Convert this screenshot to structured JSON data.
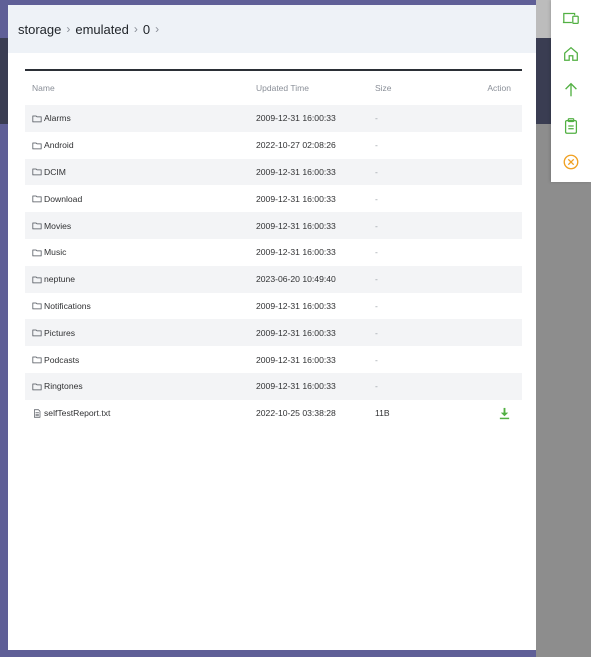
{
  "breadcrumb": [
    {
      "label": "storage"
    },
    {
      "label": "emulated"
    },
    {
      "label": "0"
    }
  ],
  "breadcrumb_separator": "›",
  "table": {
    "columns": {
      "name": "Name",
      "time": "Updated Time",
      "size": "Size",
      "action": "Action"
    },
    "rows": [
      {
        "name": "Alarms",
        "time": "2009-12-31  16:00:33",
        "size": "-",
        "type": "folder"
      },
      {
        "name": "Android",
        "time": "2022-10-27  02:08:26",
        "size": "-",
        "type": "folder"
      },
      {
        "name": "DCIM",
        "time": "2009-12-31  16:00:33",
        "size": "-",
        "type": "folder"
      },
      {
        "name": "Download",
        "time": "2009-12-31  16:00:33",
        "size": "-",
        "type": "folder"
      },
      {
        "name": "Movies",
        "time": "2009-12-31  16:00:33",
        "size": "-",
        "type": "folder"
      },
      {
        "name": "Music",
        "time": "2009-12-31  16:00:33",
        "size": "-",
        "type": "folder"
      },
      {
        "name": "neptune",
        "time": "2023-06-20  10:49:40",
        "size": "-",
        "type": "folder"
      },
      {
        "name": "Notifications",
        "time": "2009-12-31  16:00:33",
        "size": "-",
        "type": "folder"
      },
      {
        "name": "Pictures",
        "time": "2009-12-31  16:00:33",
        "size": "-",
        "type": "folder"
      },
      {
        "name": "Podcasts",
        "time": "2009-12-31  16:00:33",
        "size": "-",
        "type": "folder"
      },
      {
        "name": "Ringtones",
        "time": "2009-12-31  16:00:33",
        "size": "-",
        "type": "folder"
      },
      {
        "name": "selfTestReport.txt",
        "time": "2022-10-25  03:38:28",
        "size": "11B",
        "type": "file"
      }
    ]
  },
  "toolbar": [
    {
      "icon": "devices-icon"
    },
    {
      "icon": "home-icon"
    },
    {
      "icon": "arrow-up-icon"
    },
    {
      "icon": "clipboard-icon"
    },
    {
      "icon": "close-circle-icon"
    }
  ],
  "colors": {
    "accent_green": "#52b043",
    "close_orange": "#f0a020",
    "path_bar_bg": "#eef2f7",
    "overlay": "#5f5f97"
  }
}
